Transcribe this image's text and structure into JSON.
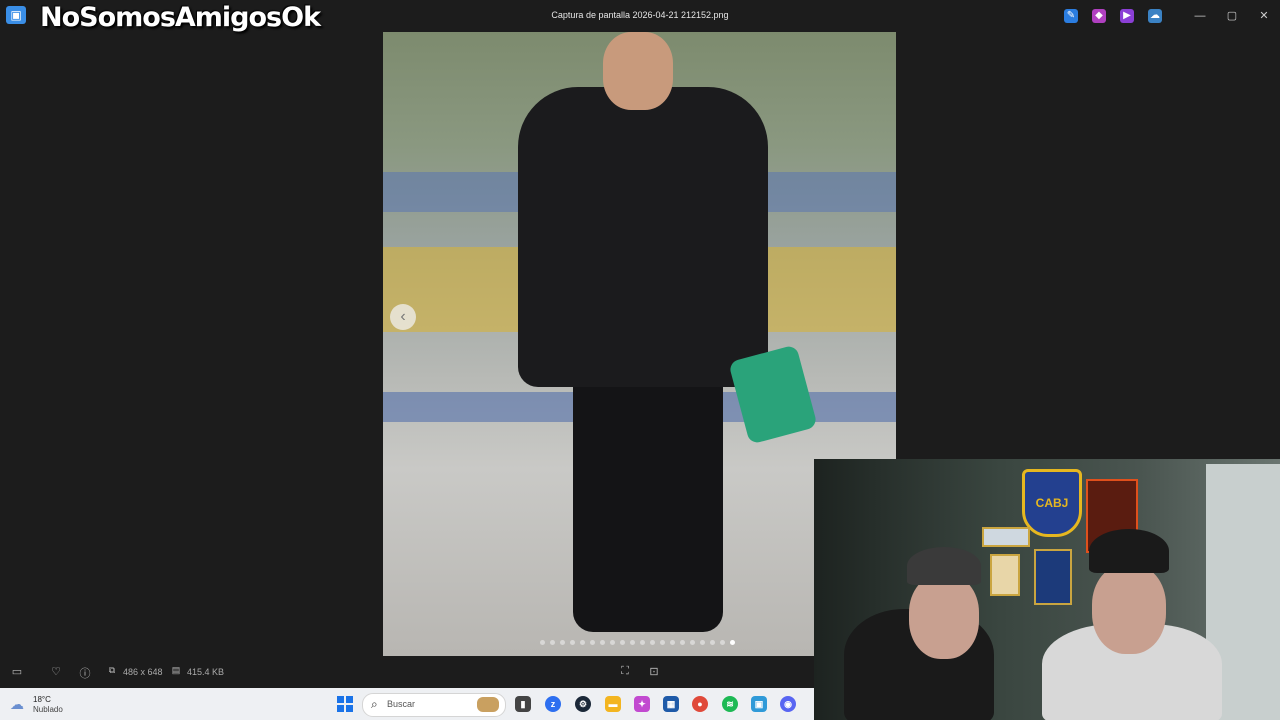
{
  "window": {
    "title": "Captura de pantalla 2026-04-21 212152.png",
    "watermark": "NoSomosAmigosOk",
    "app_icon": "photos-app-icon",
    "controls": [
      "minimize",
      "maximize",
      "close"
    ]
  },
  "viewer": {
    "gallery_dots": 20,
    "active_dot": 19
  },
  "statusbar": {
    "dimensions": "486 x 648",
    "file_size": "415.4 KB"
  },
  "taskbar": {
    "weather_temp": "18°C",
    "weather_desc": "Nublado",
    "search_placeholder": "Buscar",
    "apps": [
      "task-view",
      "zoom",
      "steam",
      "file-explorer",
      "copilot",
      "store",
      "chrome",
      "spotify",
      "photos",
      "discord"
    ]
  },
  "webcam": {
    "badge_text": "CABJ"
  },
  "colors": {
    "window_bg": "#1c1c1c",
    "taskbar_bg": "#eef0f3",
    "accent": "#1a73e8"
  }
}
